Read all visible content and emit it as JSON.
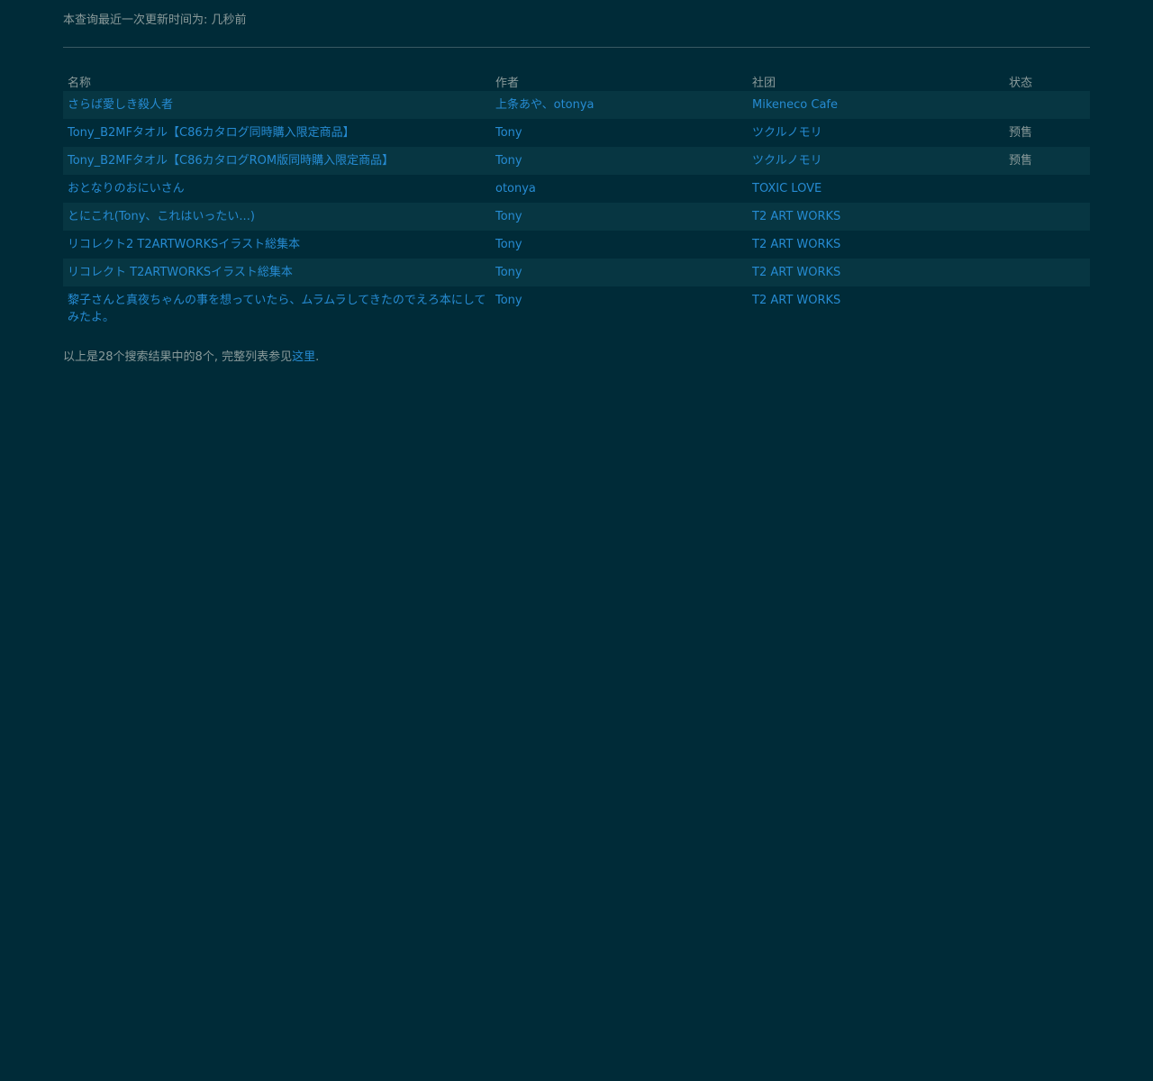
{
  "header": {
    "update_prefix": "本查询最近一次更新时间为: ",
    "update_value": "几秒前"
  },
  "table": {
    "columns": [
      "名称",
      "作者",
      "社团",
      "状态"
    ],
    "rows": [
      {
        "name": "さらば愛しき殺人者",
        "author": "上条あや、otonya",
        "circle": "Mikeneco Cafe",
        "status": ""
      },
      {
        "name": "Tony_B2MFタオル【C86カタログ同時購入限定商品】",
        "author": "Tony",
        "circle": "ツクルノモリ",
        "status": "预售"
      },
      {
        "name": "Tony_B2MFタオル【C86カタログROM版同時購入限定商品】",
        "author": "Tony",
        "circle": "ツクルノモリ",
        "status": "预售"
      },
      {
        "name": "おとなりのおにいさん",
        "author": "otonya",
        "circle": "TOXIC LOVE",
        "status": ""
      },
      {
        "name": "とにこれ(Tony、これはいったい...)",
        "author": "Tony",
        "circle": "T2 ART WORKS",
        "status": ""
      },
      {
        "name": "リコレクト2 T2ARTWORKSイラスト総集本",
        "author": "Tony",
        "circle": "T2 ART WORKS",
        "status": ""
      },
      {
        "name": "リコレクト T2ARTWORKSイラスト総集本",
        "author": "Tony",
        "circle": "T2 ART WORKS",
        "status": ""
      },
      {
        "name": "黎子さんと真夜ちゃんの事を想っていたら、ムラムラしてきたのでえろ本にしてみたよ。",
        "author": "Tony",
        "circle": "T2 ART WORKS",
        "status": ""
      }
    ]
  },
  "footer": {
    "prefix": "以上是28个搜索结果中的8个, 完整列表参见",
    "link": "这里",
    "suffix": "."
  },
  "colors": {
    "background": "#002b38",
    "row_stripe": "#073642",
    "link": "#268bd2",
    "muted_text": "#8a9a9a",
    "rule": "#3a5963"
  }
}
